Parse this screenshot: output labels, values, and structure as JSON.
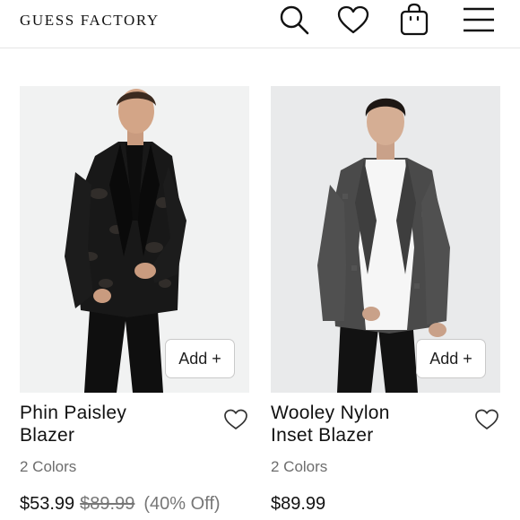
{
  "header": {
    "brand": "GUESS FACTORY",
    "icons": [
      "search-icon",
      "heart-icon",
      "shopping-bag-icon",
      "menu-icon"
    ]
  },
  "products": [
    {
      "name_line1": "Phin Paisley",
      "name_line2": "Blazer",
      "colors": "2 Colors",
      "price": "$53.99",
      "original_price": "$89.99",
      "discount": "(40% Off)",
      "add_label": "Add +"
    },
    {
      "name_line1": "Wooley Nylon",
      "name_line2": "Inset Blazer",
      "colors": "2 Colors",
      "price": "$89.99",
      "add_label": "Add +"
    }
  ],
  "colors": {
    "text": "#111111",
    "muted": "#6d6d6d",
    "photo_bg": "#eef0f1",
    "blazer_black": "#151515",
    "blazer_gray": "#4a4a4a"
  }
}
